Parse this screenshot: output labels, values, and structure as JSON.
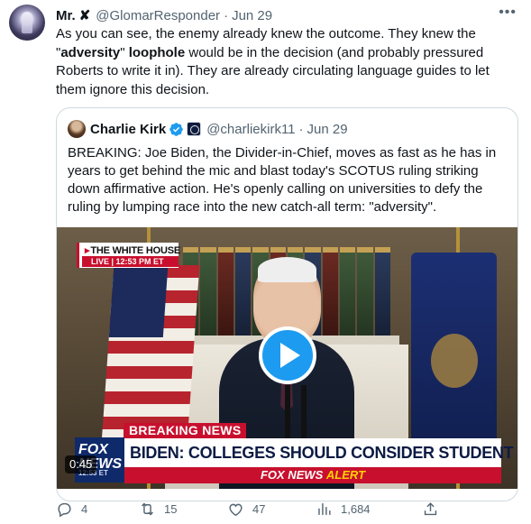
{
  "tweet": {
    "author": {
      "name": "Mr.",
      "name_suffix": "✘",
      "handle": "@GlomarResponder",
      "separator": "·",
      "date": "Jun 29"
    },
    "more_icon": "ellipsis-icon",
    "text_parts": {
      "p1": "As you can see, the enemy already knew the outcome. They knew the \"",
      "b1": "adversity",
      "p2": "\" ",
      "b2": "loophole",
      "p3": " would be in the decision (and probably pressured Roberts to write it in). They are already circulating language guides to let them ignore this decision."
    }
  },
  "quote": {
    "author": {
      "name": "Charlie Kirk",
      "handle": "@charliekirk11",
      "separator": "·",
      "date": "Jun 29"
    },
    "verified_color": "#1d9bf0",
    "text": "BREAKING: Joe Biden, the Divider-in-Chief, moves as fast as he has in years to get behind the mic and blast today's SCOTUS ruling striking down affirmative action. He's openly calling on universities to defy the ruling by lumping race into the new catch-all term: \"adversity\".",
    "video": {
      "wh_title": "THE WHITE HOUSE",
      "wh_live": "LIVE  |  12:53 PM ET",
      "breaking_label": "BREAKING NEWS",
      "network_logo": "FOX NEWS",
      "network_time": "12:53 ET",
      "chyron": "BIDEN: COLLEGES SHOULD CONSIDER STUDENT ADVERSITY",
      "alert_prefix": "FOX NEWS ",
      "alert_word": "ALERT",
      "duration": "0:45"
    }
  },
  "actions": {
    "replies": "4",
    "reposts": "15",
    "likes": "47",
    "views": "1,684"
  }
}
